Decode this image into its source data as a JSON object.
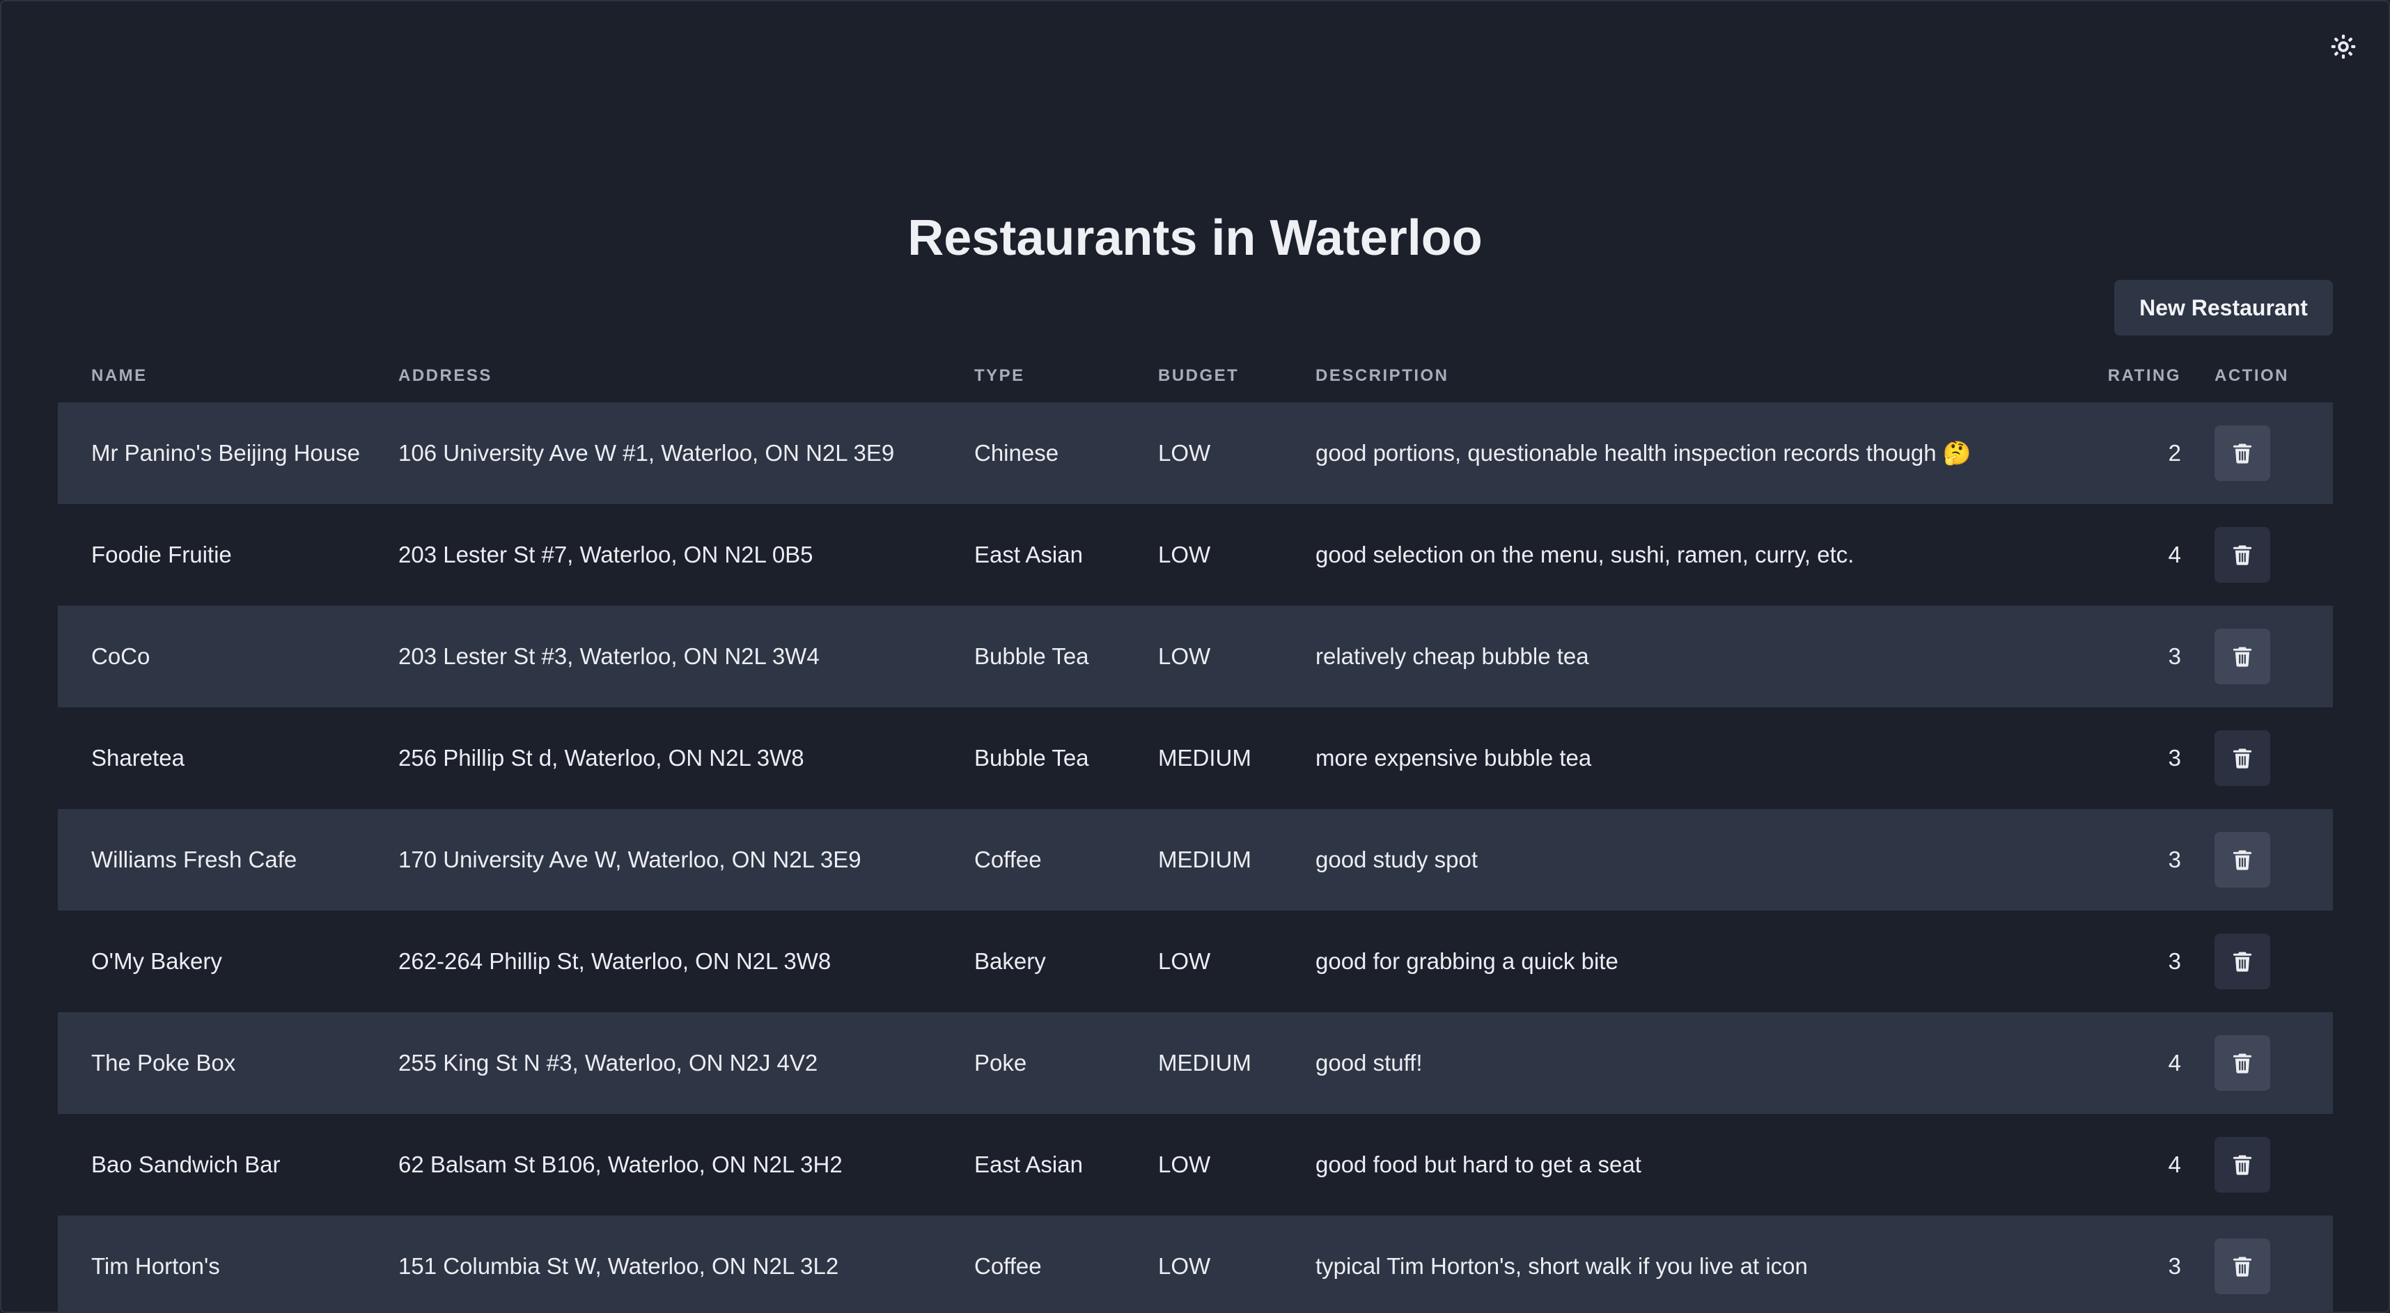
{
  "page": {
    "title": "Restaurants in Waterloo",
    "new_button_label": "New Restaurant",
    "theme_toggle_icon": "sun-icon"
  },
  "colors": {
    "background": "#1b202b",
    "row_alt": "#2e3545",
    "button": "#2e3544"
  },
  "table": {
    "headers": {
      "name": "NAME",
      "address": "ADDRESS",
      "type": "TYPE",
      "budget": "BUDGET",
      "description": "DESCRIPTION",
      "rating": "RATING",
      "action": "ACTION"
    },
    "delete_icon": "trash-icon",
    "rows": [
      {
        "name": "Mr Panino's Beijing House",
        "address": "106 University Ave W #1, Waterloo, ON N2L 3E9",
        "type": "Chinese",
        "budget": "LOW",
        "description": "good portions, questionable health inspection records though 🤔",
        "rating": "2"
      },
      {
        "name": "Foodie Fruitie",
        "address": "203 Lester St #7, Waterloo, ON N2L 0B5",
        "type": "East Asian",
        "budget": "LOW",
        "description": "good selection on the menu, sushi, ramen, curry, etc.",
        "rating": "4"
      },
      {
        "name": "CoCo",
        "address": "203 Lester St #3, Waterloo, ON N2L 3W4",
        "type": "Bubble Tea",
        "budget": "LOW",
        "description": "relatively cheap bubble tea",
        "rating": "3"
      },
      {
        "name": "Sharetea",
        "address": "256 Phillip St d, Waterloo, ON N2L 3W8",
        "type": "Bubble Tea",
        "budget": "MEDIUM",
        "description": "more expensive bubble tea",
        "rating": "3"
      },
      {
        "name": "Williams Fresh Cafe",
        "address": "170 University Ave W, Waterloo, ON N2L 3E9",
        "type": "Coffee",
        "budget": "MEDIUM",
        "description": "good study spot",
        "rating": "3"
      },
      {
        "name": "O'My Bakery",
        "address": "262-264 Phillip St, Waterloo, ON N2L 3W8",
        "type": "Bakery",
        "budget": "LOW",
        "description": "good for grabbing a quick bite",
        "rating": "3"
      },
      {
        "name": "The Poke Box",
        "address": "255 King St N #3, Waterloo, ON N2J 4V2",
        "type": "Poke",
        "budget": "MEDIUM",
        "description": "good stuff!",
        "rating": "4"
      },
      {
        "name": "Bao Sandwich Bar",
        "address": "62 Balsam St B106, Waterloo, ON N2L 3H2",
        "type": "East Asian",
        "budget": "LOW",
        "description": "good food but hard to get a seat",
        "rating": "4"
      },
      {
        "name": "Tim Horton's",
        "address": "151 Columbia St W, Waterloo, ON N2L 3L2",
        "type": "Coffee",
        "budget": "LOW",
        "description": "typical Tim Horton's, short walk if you live at icon",
        "rating": "3"
      }
    ]
  }
}
